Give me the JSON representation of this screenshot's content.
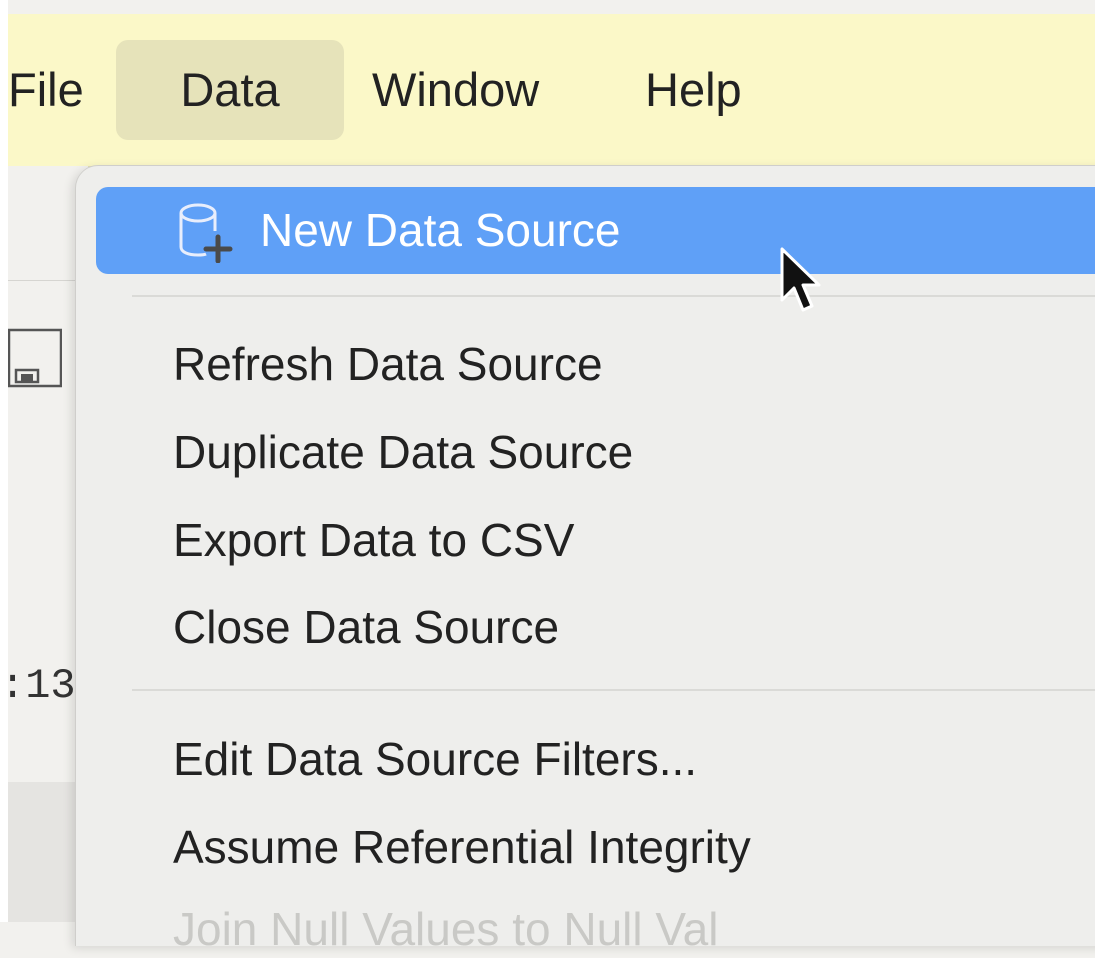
{
  "menubar": {
    "items": [
      {
        "label": "File",
        "active": false
      },
      {
        "label": "Data",
        "active": true
      },
      {
        "label": "Window",
        "active": false
      },
      {
        "label": "Help",
        "active": false
      }
    ]
  },
  "background": {
    "partial_text": ":13"
  },
  "dropdown": {
    "items": [
      {
        "label": "New Data Source",
        "icon": "database-add-icon",
        "highlighted": true
      },
      {
        "label": "Refresh Data Source"
      },
      {
        "label": "Duplicate Data Source"
      },
      {
        "label": "Export Data to CSV"
      },
      {
        "label": "Close Data Source"
      },
      {
        "label": "Edit Data Source Filters..."
      },
      {
        "label": "Assume Referential Integrity"
      },
      {
        "label": "Join Null Values to Null Val",
        "partially_visible": true
      }
    ]
  },
  "colors": {
    "menubar_bg": "#fbf8c8",
    "menubar_active_bg": "#e6e3ba",
    "highlight": "#5fa0f7",
    "dropdown_bg": "#eeeeec"
  }
}
